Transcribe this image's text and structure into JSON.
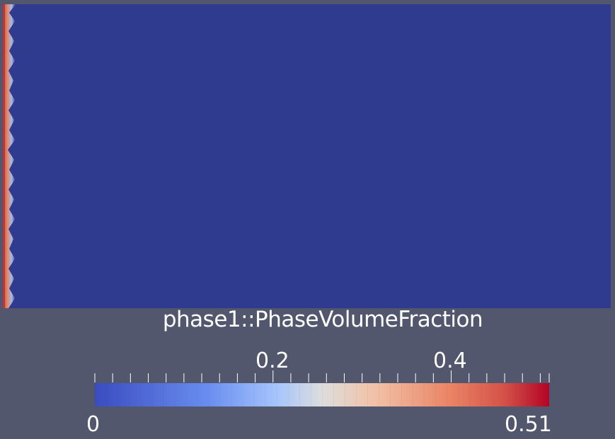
{
  "scalar_bar": {
    "title": "phase1::PhaseVolumeFraction",
    "range_min_label": "0",
    "range_max_label": "0.51",
    "range": [
      0,
      0.51
    ],
    "annotated_ticks": [
      {
        "value": 0.2,
        "label": "0.2"
      },
      {
        "value": 0.4,
        "label": "0.4"
      }
    ],
    "minor_tick_step": 0.02,
    "colormap": "cool-to-warm",
    "color_stops": [
      "#3b4cc0",
      "#8db0fe",
      "#dddddd",
      "#f49a7b",
      "#b40426"
    ],
    "discrete_bands": 256
  },
  "render_view": {
    "background_color": "#52576e",
    "field_color": "#2f3b8e",
    "edge_color": "#c0333a"
  }
}
